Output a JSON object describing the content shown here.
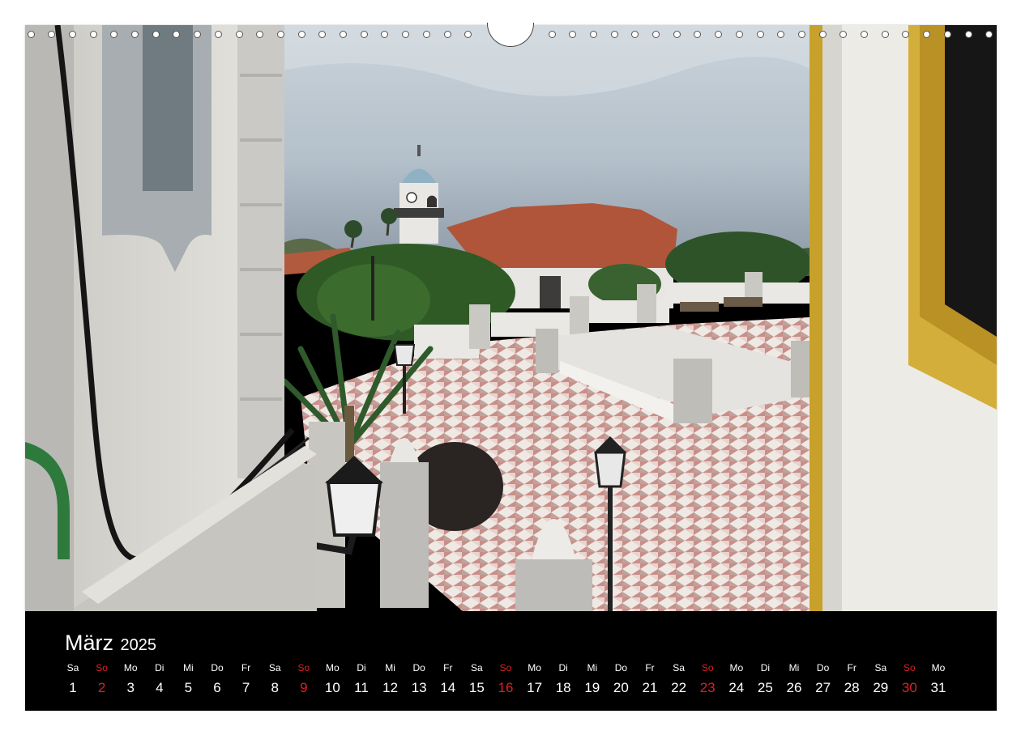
{
  "calendar": {
    "month": "März",
    "year": "2025",
    "sunday_color": "#e21e25",
    "days": [
      {
        "wd": "Sa",
        "d": "1",
        "sun": false
      },
      {
        "wd": "So",
        "d": "2",
        "sun": true
      },
      {
        "wd": "Mo",
        "d": "3",
        "sun": false
      },
      {
        "wd": "Di",
        "d": "4",
        "sun": false
      },
      {
        "wd": "Mi",
        "d": "5",
        "sun": false
      },
      {
        "wd": "Do",
        "d": "6",
        "sun": false
      },
      {
        "wd": "Fr",
        "d": "7",
        "sun": false
      },
      {
        "wd": "Sa",
        "d": "8",
        "sun": false
      },
      {
        "wd": "So",
        "d": "9",
        "sun": true
      },
      {
        "wd": "Mo",
        "d": "10",
        "sun": false
      },
      {
        "wd": "Di",
        "d": "11",
        "sun": false
      },
      {
        "wd": "Mi",
        "d": "12",
        "sun": false
      },
      {
        "wd": "Do",
        "d": "13",
        "sun": false
      },
      {
        "wd": "Fr",
        "d": "14",
        "sun": false
      },
      {
        "wd": "Sa",
        "d": "15",
        "sun": false
      },
      {
        "wd": "So",
        "d": "16",
        "sun": true
      },
      {
        "wd": "Mo",
        "d": "17",
        "sun": false
      },
      {
        "wd": "Di",
        "d": "18",
        "sun": false
      },
      {
        "wd": "Mi",
        "d": "19",
        "sun": false
      },
      {
        "wd": "Do",
        "d": "20",
        "sun": false
      },
      {
        "wd": "Fr",
        "d": "21",
        "sun": false
      },
      {
        "wd": "Sa",
        "d": "22",
        "sun": false
      },
      {
        "wd": "So",
        "d": "23",
        "sun": true
      },
      {
        "wd": "Mo",
        "d": "24",
        "sun": false
      },
      {
        "wd": "Di",
        "d": "25",
        "sun": false
      },
      {
        "wd": "Mi",
        "d": "26",
        "sun": false
      },
      {
        "wd": "Do",
        "d": "27",
        "sun": false
      },
      {
        "wd": "Fr",
        "d": "28",
        "sun": false
      },
      {
        "wd": "Sa",
        "d": "29",
        "sun": false
      },
      {
        "wd": "So",
        "d": "30",
        "sun": true
      },
      {
        "wd": "Mo",
        "d": "31",
        "sun": false
      }
    ]
  }
}
